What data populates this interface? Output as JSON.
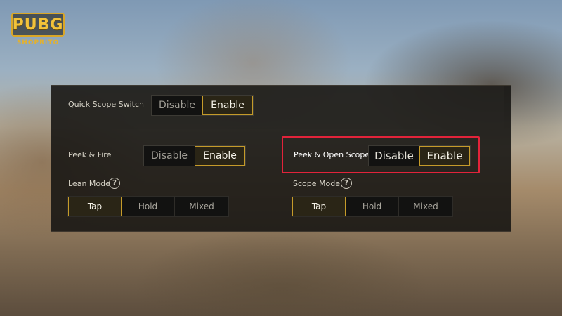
{
  "logo": {
    "text": "PUBG",
    "subtext": "SHOPRITO"
  },
  "settings": {
    "quick_scope_switch": {
      "label": "Quick Scope Switch",
      "options": [
        "Disable",
        "Enable"
      ],
      "selected": "Enable"
    },
    "peek_fire": {
      "label": "Peek & Fire",
      "options": [
        "Disable",
        "Enable"
      ],
      "selected": "Enable"
    },
    "peek_open_scope": {
      "label": "Peek & Open Scope",
      "options": [
        "Disable",
        "Enable"
      ],
      "selected": "Enable"
    },
    "lean_mode": {
      "label": "Lean Mode",
      "options": [
        "Tap",
        "Hold",
        "Mixed"
      ],
      "selected": "Tap"
    },
    "scope_mode": {
      "label": "Scope Mode",
      "options": [
        "Tap",
        "Hold",
        "Mixed"
      ],
      "selected": "Tap"
    }
  },
  "icons": {
    "help": "question-mark-circle-icon",
    "help_glyph": "?"
  },
  "colors": {
    "accent_gold": "#c59b2a",
    "highlight_red": "#e2233a",
    "logo_gold": "#d9a627"
  }
}
